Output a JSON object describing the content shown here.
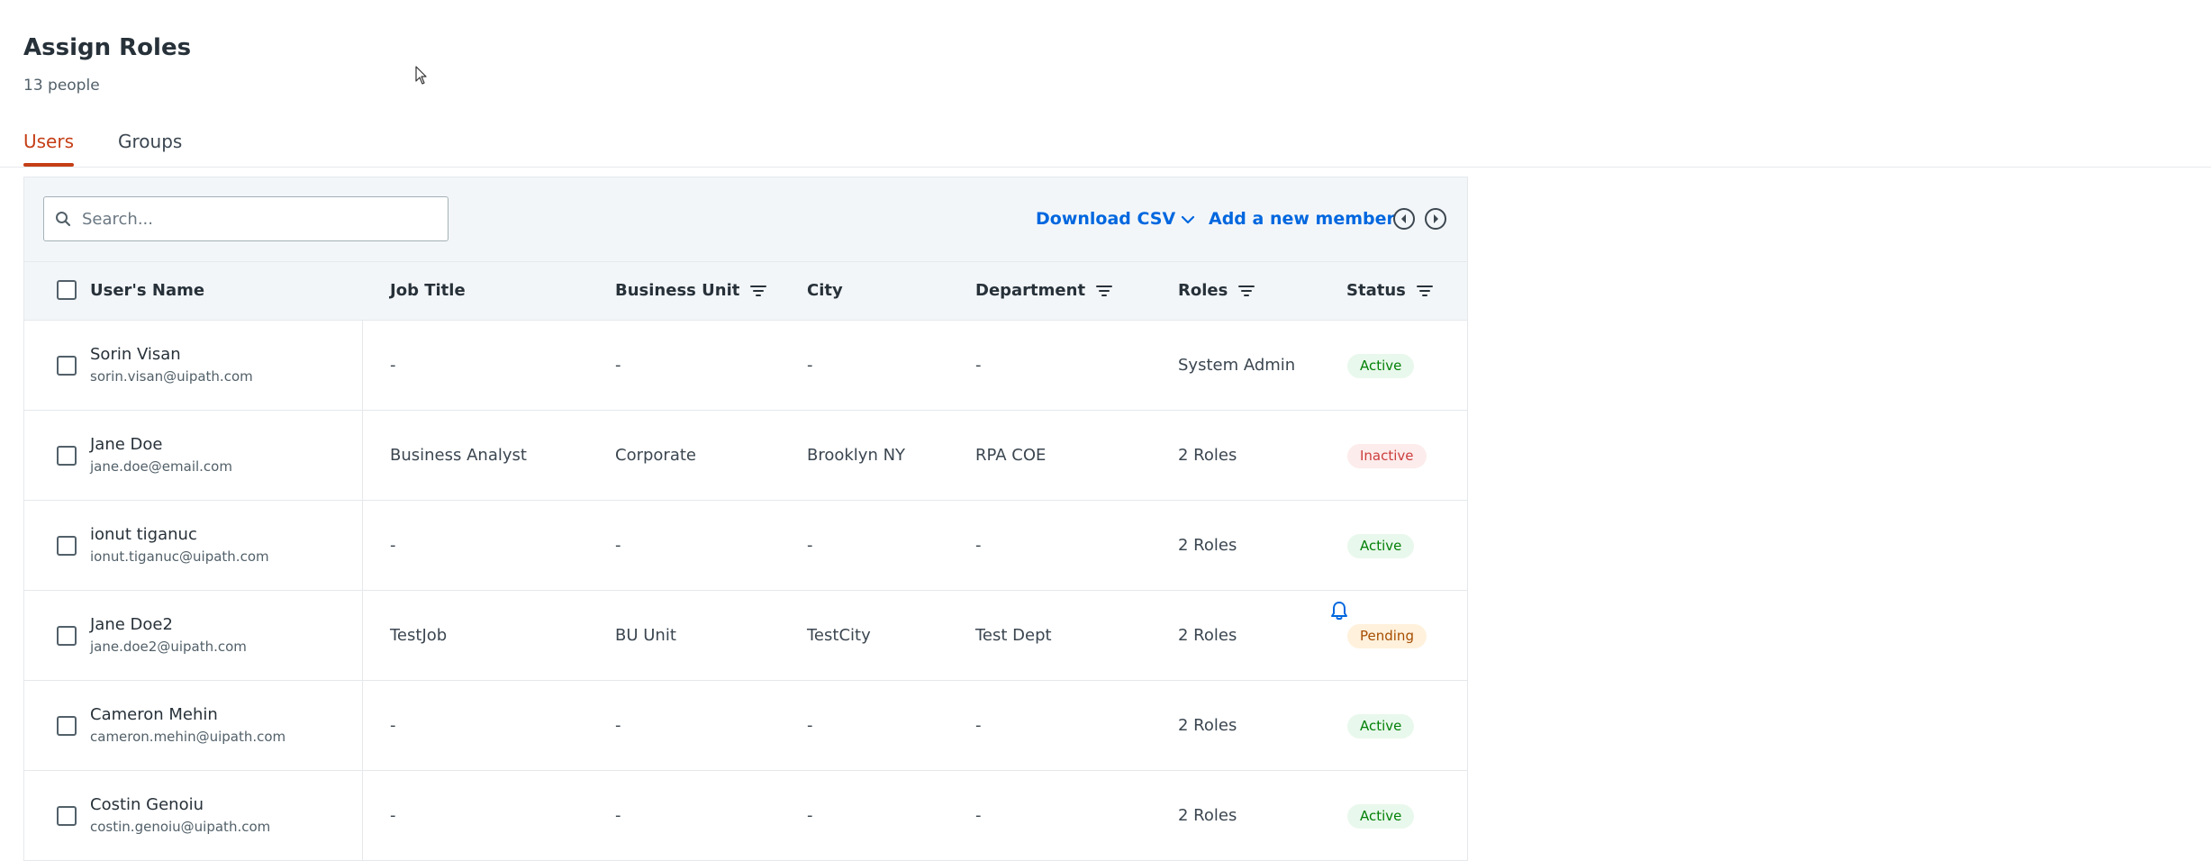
{
  "header": {
    "title": "Assign Roles",
    "subtitle": "13 people"
  },
  "tabs": [
    {
      "label": "Users",
      "active": true
    },
    {
      "label": "Groups",
      "active": false
    }
  ],
  "toolbar": {
    "search_placeholder": "Search...",
    "download_label": "Download CSV",
    "add_member_label": "Add a new member"
  },
  "columns": {
    "name": "User's Name",
    "job_title": "Job Title",
    "business_unit": "Business Unit",
    "city": "City",
    "department": "Department",
    "roles": "Roles",
    "status": "Status"
  },
  "rows": [
    {
      "name": "Sorin Visan",
      "email": "sorin.visan@uipath.com",
      "job_title": "-",
      "business_unit": "-",
      "city": "-",
      "department": "-",
      "roles": "System Admin",
      "status": "Active"
    },
    {
      "name": "Jane Doe",
      "email": "jane.doe@email.com",
      "job_title": "Business Analyst",
      "business_unit": "Corporate",
      "city": "Brooklyn NY",
      "department": "RPA COE",
      "roles": "2 Roles",
      "status": "Inactive"
    },
    {
      "name": "ionut tiganuc",
      "email": "ionut.tiganuc@uipath.com",
      "job_title": "-",
      "business_unit": "-",
      "city": "-",
      "department": "-",
      "roles": "2 Roles",
      "status": "Active"
    },
    {
      "name": "Jane Doe2",
      "email": "jane.doe2@uipath.com",
      "job_title": "TestJob",
      "business_unit": "BU Unit",
      "city": "TestCity",
      "department": "Test Dept",
      "roles": "2 Roles",
      "status": "Pending"
    },
    {
      "name": "Cameron Mehin",
      "email": "cameron.mehin@uipath.com",
      "job_title": "-",
      "business_unit": "-",
      "city": "-",
      "department": "-",
      "roles": "2 Roles",
      "status": "Active"
    },
    {
      "name": "Costin Genoiu",
      "email": "costin.genoiu@uipath.com",
      "job_title": "-",
      "business_unit": "-",
      "city": "-",
      "department": "-",
      "roles": "2 Roles",
      "status": "Active"
    }
  ],
  "colors": {
    "accent": "#c53e16",
    "link": "#0067df",
    "toolbar_bg": "#f3f6f9"
  },
  "icons": [
    "search-icon",
    "chevron-down-icon",
    "arrow-left-circle-icon",
    "arrow-right-circle-icon",
    "filter-icon",
    "bell-icon",
    "mouse-cursor-icon"
  ]
}
